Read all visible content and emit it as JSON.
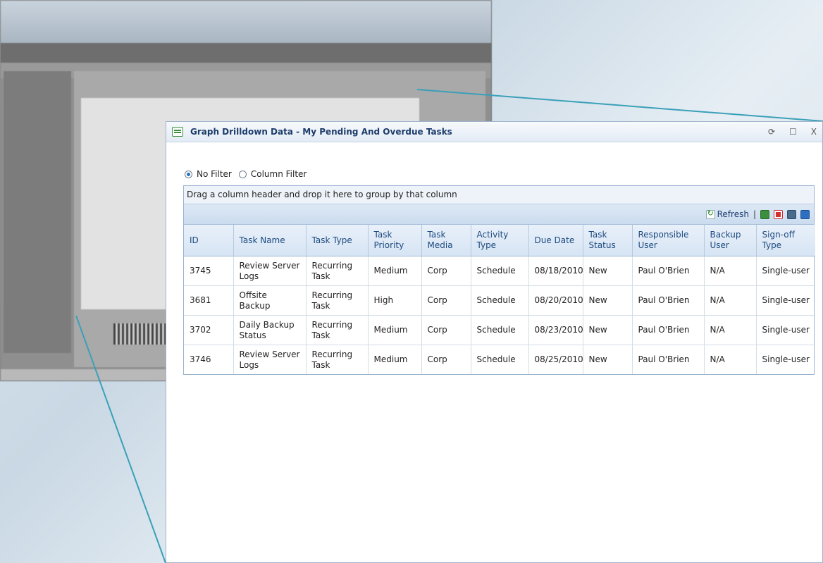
{
  "panel": {
    "title": "Graph Drilldown Data - My Pending And Overdue Tasks",
    "controls": {
      "refresh": "⟳",
      "maximize": "☐",
      "close": "X"
    }
  },
  "filters": {
    "no_filter": "No Filter",
    "column_filter": "Column Filter",
    "selected": "no_filter"
  },
  "grid": {
    "group_hint": "Drag a column header and drop it here to group by that column",
    "toolbar": {
      "refresh_label": "Refresh",
      "separator": "|"
    },
    "columns": [
      "ID",
      "Task Name",
      "Task Type",
      "Task Priority",
      "Task Media",
      "Activity Type",
      "Due Date",
      "Task Status",
      "Responsible User",
      "Backup User",
      "Sign-off Type"
    ],
    "rows": [
      [
        "3745",
        "Review Server Logs",
        "Recurring Task",
        "Medium",
        "Corp",
        "Schedule",
        "08/18/2010",
        "New",
        "Paul O'Brien",
        "N/A",
        "Single-user"
      ],
      [
        "3681",
        "Offsite Backup",
        "Recurring Task",
        "High",
        "Corp",
        "Schedule",
        "08/20/2010",
        "New",
        "Paul O'Brien",
        "N/A",
        "Single-user"
      ],
      [
        "3702",
        "Daily Backup Status",
        "Recurring Task",
        "Medium",
        "Corp",
        "Schedule",
        "08/23/2010",
        "New",
        "Paul O'Brien",
        "N/A",
        "Single-user"
      ],
      [
        "3746",
        "Review Server Logs",
        "Recurring Task",
        "Medium",
        "Corp",
        "Schedule",
        "08/25/2010",
        "New",
        "Paul O'Brien",
        "N/A",
        "Single-user"
      ]
    ]
  },
  "colors": {
    "accent": "#1d4a80",
    "connector": "#3aa0b8"
  }
}
